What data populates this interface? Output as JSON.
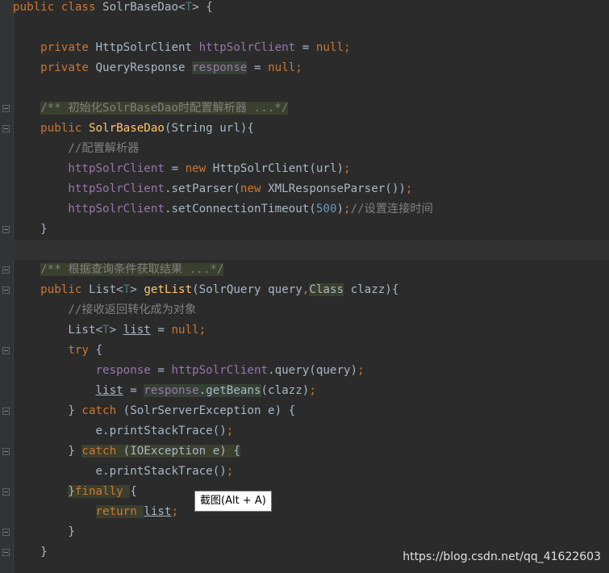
{
  "editor": {
    "language": "java",
    "lines": [
      [
        {
          "t": "public class ",
          "c": "kw"
        },
        {
          "t": "SolrBaseDao",
          "c": "cls"
        },
        {
          "t": "<",
          "c": ""
        },
        {
          "t": "T",
          "c": "tp"
        },
        {
          "t": "> {",
          "c": ""
        }
      ],
      [],
      [
        {
          "t": "    private ",
          "c": "kw"
        },
        {
          "t": "HttpSolrClient ",
          "c": ""
        },
        {
          "t": "httpSolrClient",
          "c": "fld"
        },
        {
          "t": " = ",
          "c": ""
        },
        {
          "t": "null",
          "c": "kw"
        },
        {
          "t": ";",
          "c": "kw"
        }
      ],
      [
        {
          "t": "    private ",
          "c": "kw"
        },
        {
          "t": "QueryResponse ",
          "c": ""
        },
        {
          "t": "response",
          "c": "fld hl"
        },
        {
          "t": " = ",
          "c": ""
        },
        {
          "t": "null",
          "c": "kw"
        },
        {
          "t": ";",
          "c": "kw"
        }
      ],
      [],
      [
        {
          "t": "    ",
          "c": ""
        },
        {
          "t": "/** 初始化SolrBaseDao时配置解析器 ...*/",
          "c": "cmt hlb"
        }
      ],
      [
        {
          "t": "    public ",
          "c": "kw"
        },
        {
          "t": "SolrBaseDao",
          "c": "fn"
        },
        {
          "t": "(String url){",
          "c": ""
        }
      ],
      [
        {
          "t": "        ",
          "c": ""
        },
        {
          "t": "//配置解析器",
          "c": "cmt"
        }
      ],
      [
        {
          "t": "        ",
          "c": ""
        },
        {
          "t": "httpSolrClient",
          "c": "fld"
        },
        {
          "t": " = ",
          "c": ""
        },
        {
          "t": "new ",
          "c": "kw"
        },
        {
          "t": "HttpSolrClient(url)",
          "c": ""
        },
        {
          "t": ";",
          "c": "kw"
        }
      ],
      [
        {
          "t": "        ",
          "c": ""
        },
        {
          "t": "httpSolrClient",
          "c": "fld"
        },
        {
          "t": ".setParser(",
          "c": ""
        },
        {
          "t": "new ",
          "c": "kw"
        },
        {
          "t": "XMLResponseParser())",
          "c": ""
        },
        {
          "t": ";",
          "c": "kw"
        }
      ],
      [
        {
          "t": "        ",
          "c": ""
        },
        {
          "t": "httpSolrClient",
          "c": "fld"
        },
        {
          "t": ".setConnectionTimeout(",
          "c": ""
        },
        {
          "t": "500",
          "c": "num"
        },
        {
          "t": ")",
          "c": ""
        },
        {
          "t": ";",
          "c": "kw"
        },
        {
          "t": "//设置连接时间",
          "c": "cmt"
        }
      ],
      [
        {
          "t": "    }",
          "c": ""
        }
      ],
      [],
      [
        {
          "t": "    ",
          "c": ""
        },
        {
          "t": "/** 根据查询条件获取结果 ...*/",
          "c": "cmt hlb"
        }
      ],
      [
        {
          "t": "    public ",
          "c": "kw"
        },
        {
          "t": "List<",
          "c": ""
        },
        {
          "t": "T",
          "c": "tp"
        },
        {
          "t": "> ",
          "c": ""
        },
        {
          "t": "getList",
          "c": "fn"
        },
        {
          "t": "(SolrQuery query",
          "c": ""
        },
        {
          "t": ",",
          "c": "kw"
        },
        {
          "t": "Class",
          "c": "hlb"
        },
        {
          "t": " clazz){",
          "c": ""
        }
      ],
      [
        {
          "t": "        ",
          "c": ""
        },
        {
          "t": "//接收返回转化成为对象",
          "c": "cmt"
        }
      ],
      [
        {
          "t": "        List<",
          "c": ""
        },
        {
          "t": "T",
          "c": "tp"
        },
        {
          "t": "> ",
          "c": ""
        },
        {
          "t": "list",
          "c": "u"
        },
        {
          "t": " = ",
          "c": ""
        },
        {
          "t": "null",
          "c": "kw"
        },
        {
          "t": ";",
          "c": "kw"
        }
      ],
      [
        {
          "t": "        try ",
          "c": "kw"
        },
        {
          "t": "{",
          "c": ""
        }
      ],
      [
        {
          "t": "            ",
          "c": ""
        },
        {
          "t": "response",
          "c": "fld"
        },
        {
          "t": " = ",
          "c": ""
        },
        {
          "t": "httpSolrClient",
          "c": "fld"
        },
        {
          "t": ".query(query)",
          "c": ""
        },
        {
          "t": ";",
          "c": "kw"
        }
      ],
      [
        {
          "t": "            ",
          "c": ""
        },
        {
          "t": "list",
          "c": "u"
        },
        {
          "t": " = ",
          "c": ""
        },
        {
          "t": "response",
          "c": "fld hl"
        },
        {
          "t": ".getBeans",
          "c": "hl"
        },
        {
          "t": "(clazz)",
          "c": ""
        },
        {
          "t": ";",
          "c": "kw"
        }
      ],
      [
        {
          "t": "        } ",
          "c": ""
        },
        {
          "t": "catch ",
          "c": "kw"
        },
        {
          "t": "(SolrServerException e) {",
          "c": ""
        }
      ],
      [
        {
          "t": "            e.printStackTrace()",
          "c": ""
        },
        {
          "t": ";",
          "c": "kw"
        }
      ],
      [
        {
          "t": "        } ",
          "c": ""
        },
        {
          "t": "catch",
          "c": "kw hlb"
        },
        {
          "t": " (IOException e) {",
          "c": "hlb"
        }
      ],
      [
        {
          "t": "            e.printStackTrace()",
          "c": ""
        },
        {
          "t": ";",
          "c": "kw"
        }
      ],
      [
        {
          "t": "        ",
          "c": ""
        },
        {
          "t": "}",
          "c": "hlb"
        },
        {
          "t": "finally ",
          "c": "kw hlb"
        },
        {
          "t": "{",
          "c": ""
        }
      ],
      [
        {
          "t": "            ",
          "c": ""
        },
        {
          "t": "return ",
          "c": "kw hlb"
        },
        {
          "t": "list",
          "c": "u"
        },
        {
          "t": ";",
          "c": "kw"
        }
      ],
      [
        {
          "t": "        }",
          "c": ""
        }
      ],
      [
        {
          "t": "    }",
          "c": ""
        }
      ]
    ],
    "current_line": 12,
    "fold_markers": [
      5,
      6,
      11,
      13,
      14,
      17,
      20,
      22,
      24,
      26,
      27
    ]
  },
  "tooltip": {
    "text": "截图(Alt + A)"
  },
  "watermark": {
    "text": "https://blog.csdn.net/qq_41622603"
  }
}
